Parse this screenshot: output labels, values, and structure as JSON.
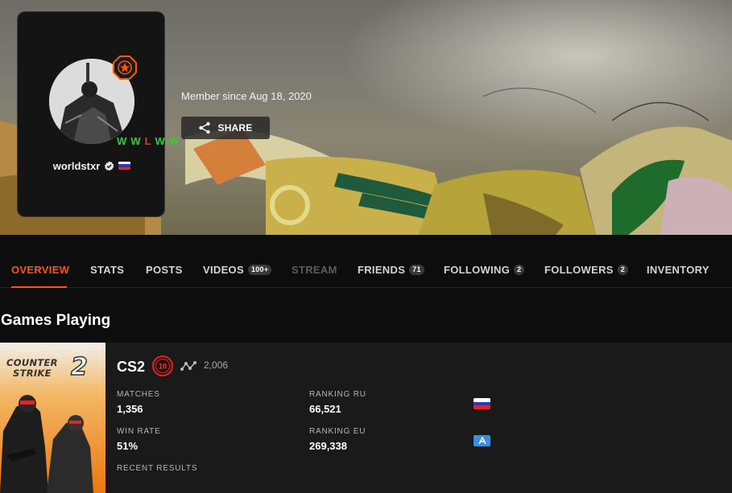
{
  "profile": {
    "username": "worldstxr",
    "member_since": "Member since Aug 18, 2020",
    "share_label": "SHARE",
    "country_flag_colors": [
      "#ffffff",
      "#1c3fbf",
      "#d9262c"
    ],
    "level_badge_color": "#ff5500"
  },
  "tabs": [
    {
      "label": "OVERVIEW",
      "count": null,
      "state": "active"
    },
    {
      "label": "STATS",
      "count": null,
      "state": "normal"
    },
    {
      "label": "POSTS",
      "count": null,
      "state": "normal"
    },
    {
      "label": "VIDEOS",
      "count": "100+",
      "state": "normal"
    },
    {
      "label": "STREAM",
      "count": null,
      "state": "disabled"
    },
    {
      "label": "FRIENDS",
      "count": "71",
      "state": "normal"
    },
    {
      "label": "FOLLOWING",
      "count": "2",
      "state": "normal"
    },
    {
      "label": "FOLLOWERS",
      "count": "2",
      "state": "normal"
    },
    {
      "label": "INVENTORY",
      "count": null,
      "state": "normal"
    }
  ],
  "section_title": "Games Playing",
  "game": {
    "cover_text_1": "COUNTER",
    "cover_text_2": "STRIKE",
    "cover_text_3": "2",
    "name": "CS2",
    "skill_level": "10",
    "elo": "2,006",
    "matches_label": "MATCHES",
    "matches": "1,356",
    "win_rate_label": "WIN RATE",
    "win_rate": "51%",
    "ranking_ru_label": "RANKING RU",
    "ranking_ru": "66,521",
    "ranking_eu_label": "RANKING EU",
    "ranking_eu": "269,338",
    "recent_results_label": "RECENT RESULTS",
    "recent_results": [
      "W",
      "W",
      "L",
      "W",
      "W"
    ]
  },
  "colors": {
    "accent": "#ff5500",
    "win": "#2fd12f",
    "loss": "#ff2a2a"
  }
}
